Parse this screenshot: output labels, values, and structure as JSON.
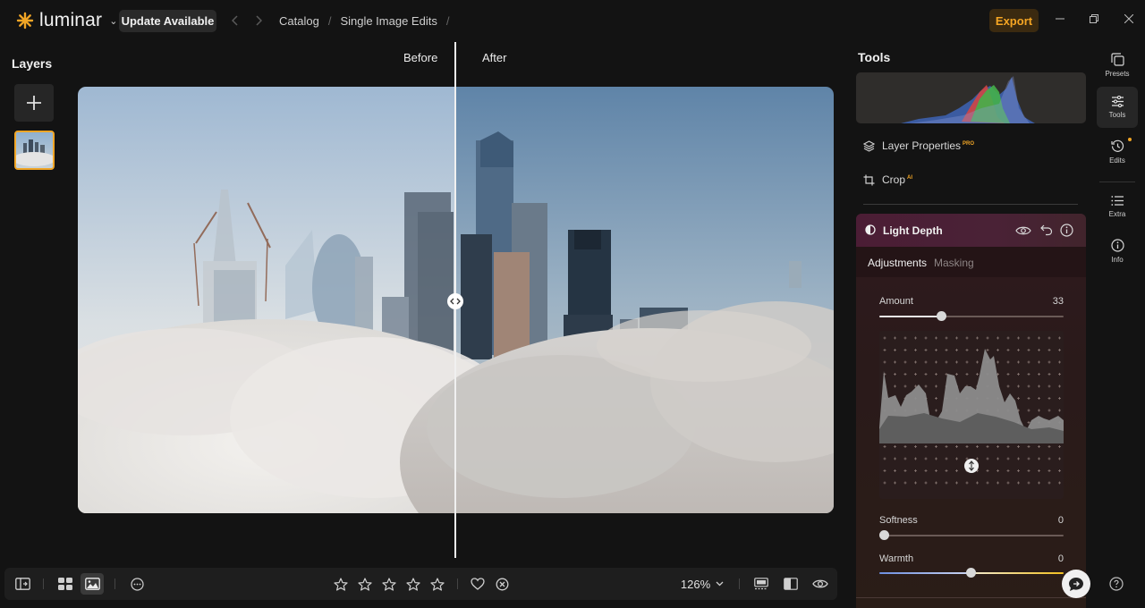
{
  "titlebar": {
    "logo_text": "luminar",
    "update_label": "Update Available",
    "breadcrumbs": [
      "Catalog",
      "/",
      "Single Image Edits",
      "/"
    ],
    "export_label": "Export"
  },
  "layers": {
    "title": "Layers"
  },
  "canvas": {
    "before_label": "Before",
    "after_label": "After"
  },
  "bottombar": {
    "rating_stars": 5,
    "zoom": "126%"
  },
  "tools": {
    "title": "Tools",
    "layer_properties": "Layer Properties",
    "layer_properties_badge": "PRO",
    "crop": "Crop",
    "crop_badge": "AI",
    "light_depth": {
      "title": "Light Depth",
      "tabs": [
        "Adjustments",
        "Masking"
      ],
      "amount_label": "Amount",
      "amount_value": "33",
      "softness_label": "Softness",
      "softness_value": "0",
      "warmth_label": "Warmth",
      "warmth_value": "0"
    }
  },
  "rail": {
    "presets": "Presets",
    "tools": "Tools",
    "edits": "Edits",
    "extra": "Extra",
    "info": "Info"
  },
  "colors": {
    "accent": "#f0a526",
    "panel_header": "#4b1d35"
  }
}
